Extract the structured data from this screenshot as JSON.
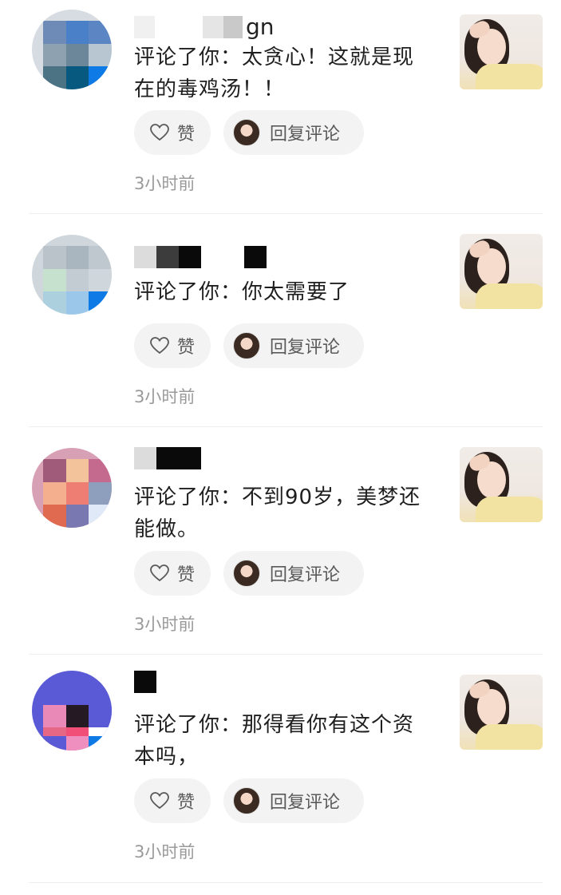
{
  "notifications": [
    {
      "name_fragment": "gn",
      "comment": "评论了你：太贪心！这就是现在的毒鸡汤！！",
      "like_label": "赞",
      "reply_label": "回复评论",
      "time": "3小时前"
    },
    {
      "name_fragment": "",
      "comment": "评论了你：你太需要了",
      "like_label": "赞",
      "reply_label": "回复评论",
      "time": "3小时前"
    },
    {
      "name_fragment": "",
      "comment": "评论了你：不到90岁，美梦还能做。",
      "like_label": "赞",
      "reply_label": "回复评论",
      "time": "3小时前"
    },
    {
      "name_fragment": "",
      "comment": "评论了你：那得看你有这个资本吗，",
      "like_label": "赞",
      "reply_label": "回复评论",
      "time": "3小时前"
    }
  ],
  "colors": {
    "pill_bg": "#f3f3f3",
    "time_text": "#9a9a9a",
    "divider": "#eeeeee"
  },
  "icons": {
    "like": "heart-icon",
    "reply_avatar": "avatar",
    "thumbnail": "post-thumbnail"
  }
}
